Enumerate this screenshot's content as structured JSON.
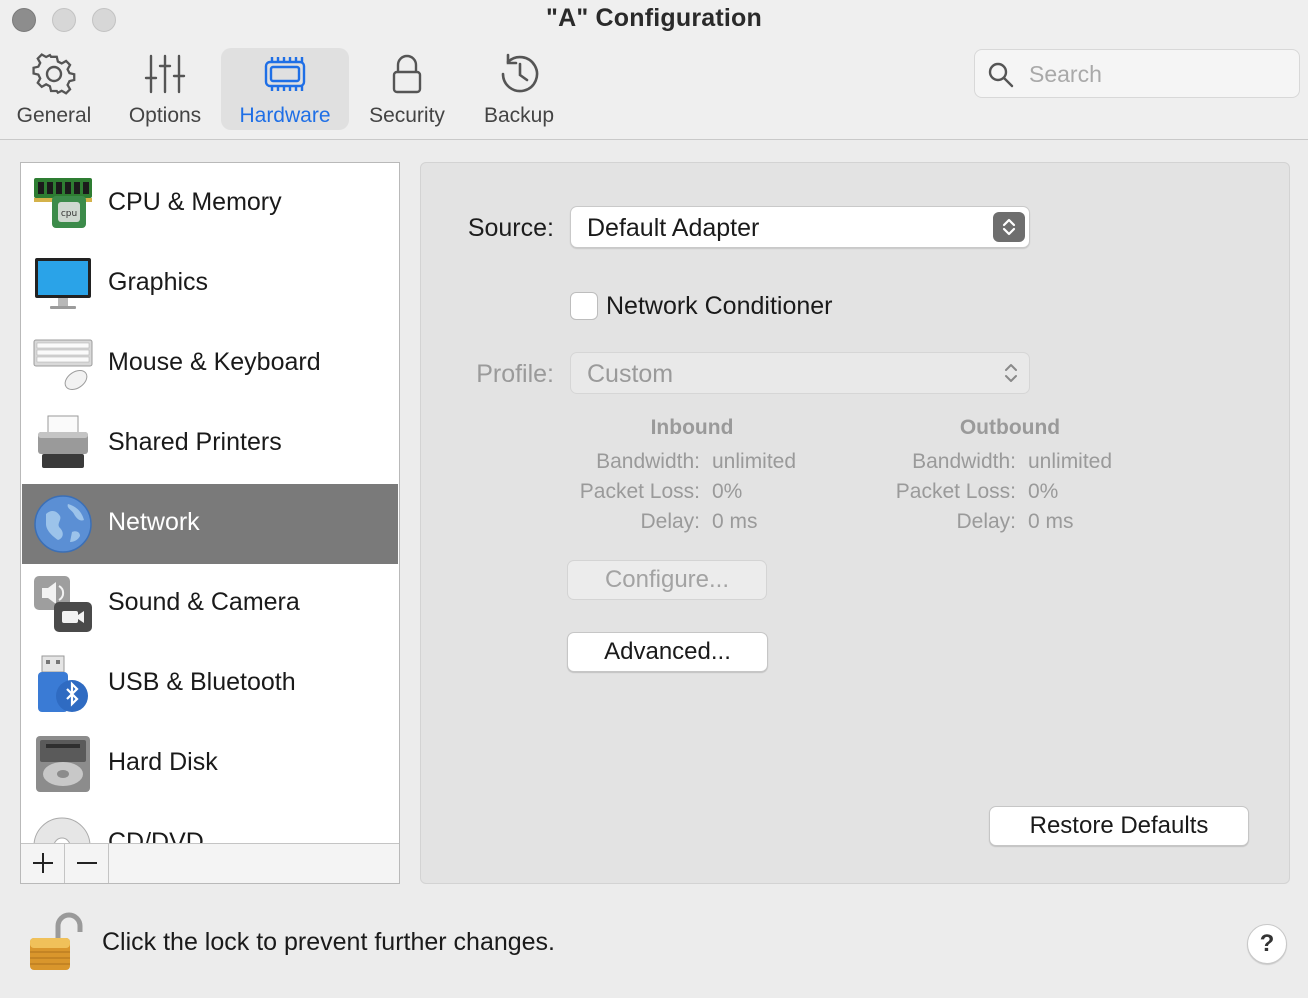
{
  "window": {
    "title": "\"A\" Configuration"
  },
  "toolbar": {
    "items": [
      {
        "label": "General",
        "icon": "gear-icon",
        "selected": false
      },
      {
        "label": "Options",
        "icon": "sliders-icon",
        "selected": false
      },
      {
        "label": "Hardware",
        "icon": "chip-icon",
        "selected": true
      },
      {
        "label": "Security",
        "icon": "lock-icon",
        "selected": false
      },
      {
        "label": "Backup",
        "icon": "clock-history-icon",
        "selected": false
      }
    ],
    "search_placeholder": "Search",
    "accent_color": "#1f6fe6"
  },
  "sidebar": {
    "items": [
      {
        "label": "CPU & Memory",
        "icon": "cpu-memory-icon"
      },
      {
        "label": "Graphics",
        "icon": "monitor-icon"
      },
      {
        "label": "Mouse & Keyboard",
        "icon": "keyboard-mouse-icon"
      },
      {
        "label": "Shared Printers",
        "icon": "printer-icon"
      },
      {
        "label": "Network",
        "icon": "globe-icon",
        "selected": true
      },
      {
        "label": "Sound & Camera",
        "icon": "speaker-camera-icon"
      },
      {
        "label": "USB & Bluetooth",
        "icon": "usb-bluetooth-icon"
      },
      {
        "label": "Hard Disk",
        "icon": "hard-disk-icon"
      },
      {
        "label": "CD/DVD",
        "icon": "disc-icon"
      }
    ],
    "add_symbol": "+",
    "remove_symbol": "−"
  },
  "network": {
    "source_label": "Source:",
    "source_value": "Default Adapter",
    "conditioner_label": "Network Conditioner",
    "conditioner_checked": false,
    "profile_label": "Profile:",
    "profile_value": "Custom",
    "inbound": {
      "heading": "Inbound",
      "bandwidth_key": "Bandwidth:",
      "bandwidth": "unlimited",
      "loss_key": "Packet Loss:",
      "loss": "0%",
      "delay_key": "Delay:",
      "delay": "0 ms"
    },
    "outbound": {
      "heading": "Outbound",
      "bandwidth_key": "Bandwidth:",
      "bandwidth": "unlimited",
      "loss_key": "Packet Loss:",
      "loss": "0%",
      "delay_key": "Delay:",
      "delay": "0 ms"
    },
    "configure_label": "Configure...",
    "advanced_label": "Advanced...",
    "restore_label": "Restore Defaults"
  },
  "footer": {
    "lock_text": "Click the lock to prevent further changes.",
    "help_label": "?"
  }
}
